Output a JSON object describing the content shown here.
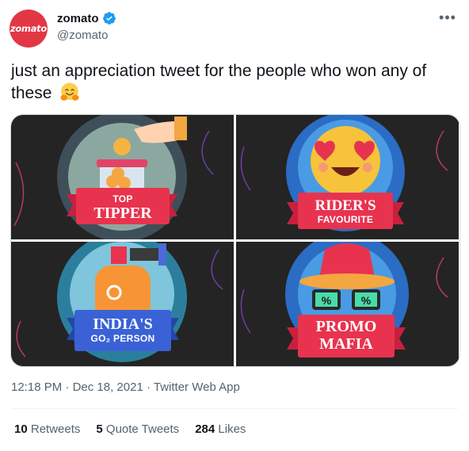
{
  "author": {
    "avatar_text": "zomato",
    "display_name": "zomato",
    "handle": "@zomato",
    "verified": true
  },
  "tweet": {
    "text": "just an appreciation tweet for the people who won any of these",
    "emoji": "hugging-face-emoji"
  },
  "media": {
    "tiles": [
      {
        "line1": "TOP",
        "line2": "TIPPER",
        "style": "small-top"
      },
      {
        "line1": "RIDER'S",
        "line2": "FAVOURITE",
        "style": "small-bottom"
      },
      {
        "line1": "INDIA'S",
        "line2": "GO₂ PERSON",
        "style": "small-bottom"
      },
      {
        "line1": "PROMO",
        "line2": "MAFIA",
        "style": "two-big"
      }
    ]
  },
  "meta": {
    "time": "12:18 PM",
    "date": "Dec 18, 2021",
    "source": "Twitter Web App"
  },
  "stats": {
    "retweets_count": "10",
    "retweets_label": "Retweets",
    "quotes_count": "5",
    "quotes_label": "Quote Tweets",
    "likes_count": "284",
    "likes_label": "Likes"
  },
  "colors": {
    "brand": "#e23744",
    "verified": "#1d9bf0",
    "ribbon": "#e8334f",
    "ribbon_blue": "#2d58c8"
  }
}
